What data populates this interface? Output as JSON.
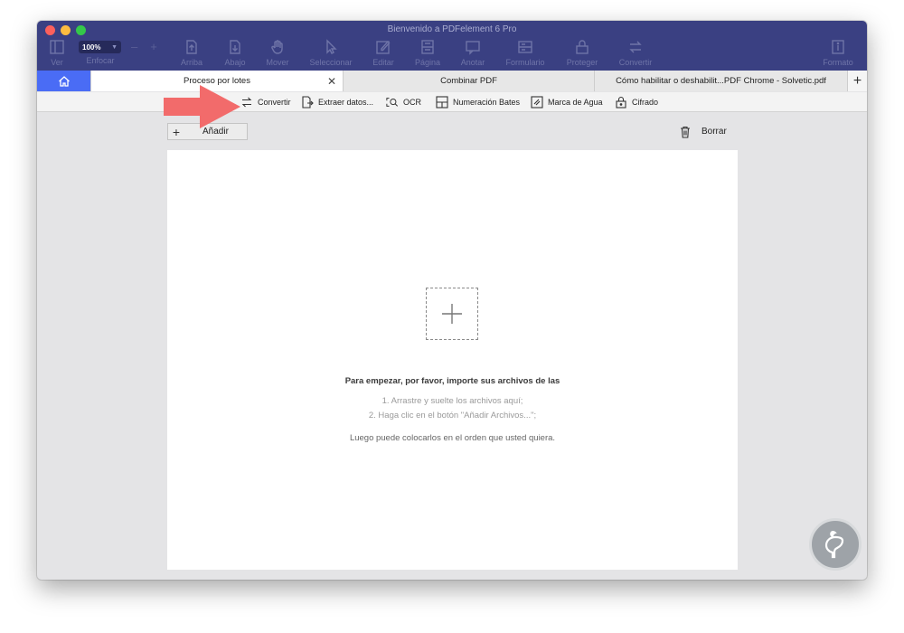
{
  "window": {
    "title": "Bienvenido a PDFelement 6 Pro"
  },
  "toolbar": {
    "zoom": "100%",
    "items": [
      {
        "label": "Ver",
        "icon": "view-icon"
      },
      {
        "label": "Enfocar",
        "icon": "focus-icon"
      },
      {
        "label": "Arriba",
        "icon": "page-up-icon"
      },
      {
        "label": "Abajo",
        "icon": "page-down-icon"
      },
      {
        "label": "Mover",
        "icon": "hand-icon"
      },
      {
        "label": "Seleccionar",
        "icon": "cursor-icon"
      },
      {
        "label": "Editar",
        "icon": "edit-icon"
      },
      {
        "label": "Página",
        "icon": "page-icon"
      },
      {
        "label": "Anotar",
        "icon": "annotate-icon"
      },
      {
        "label": "Formulario",
        "icon": "form-icon"
      },
      {
        "label": "Proteger",
        "icon": "lock-icon"
      },
      {
        "label": "Convertir",
        "icon": "convert-icon"
      },
      {
        "label": "Formato",
        "icon": "format-icon"
      }
    ]
  },
  "tabs": {
    "items": [
      {
        "label": "Proceso por lotes",
        "active": true
      },
      {
        "label": "Combinar PDF",
        "active": false
      },
      {
        "label": "Cómo habilitar o deshabilit...PDF Chrome - Solvetic.pdf",
        "active": false
      }
    ],
    "close_glyph": "✕",
    "add_glyph": "+"
  },
  "subtoolbar": {
    "items": [
      {
        "label": "Convertir",
        "icon": "convert-icon"
      },
      {
        "label": "Extraer datos...",
        "icon": "extract-icon"
      },
      {
        "label": "OCR",
        "icon": "ocr-icon"
      },
      {
        "label": "Numeración Bates",
        "icon": "bates-icon"
      },
      {
        "label": "Marca de Agua",
        "icon": "watermark-icon"
      },
      {
        "label": "Cifrado",
        "icon": "lock-icon"
      }
    ]
  },
  "actions": {
    "add_label": "Añadir",
    "delete_label": "Borrar"
  },
  "drop_area": {
    "title": "Para empezar, por favor, importe sus archivos de las",
    "steps": [
      "1. Arrastre y suelte los archivos aquí;",
      "2. Haga clic en el botón \"Añadir Archivos...\";"
    ],
    "note": "Luego puede colocarlos en el orden que usted quiera."
  },
  "colors": {
    "titlebar": "#3a4082",
    "accent": "#4a6cf5",
    "annotation_arrow": "#f26b6b"
  }
}
